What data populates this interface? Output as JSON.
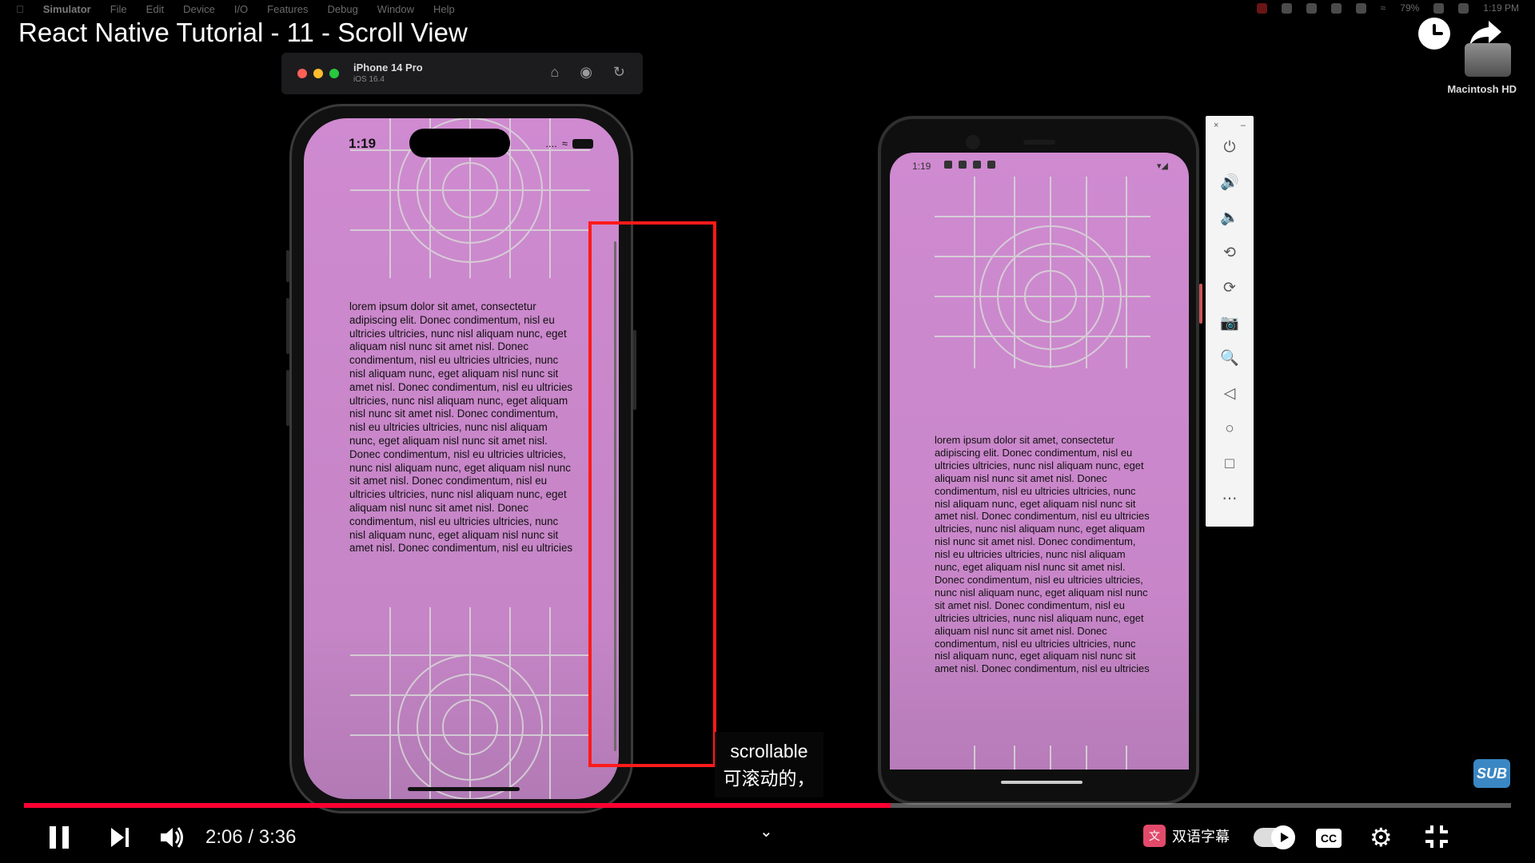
{
  "menubar": {
    "app": "Simulator",
    "items": [
      "File",
      "Edit",
      "Device",
      "I/O",
      "Features",
      "Debug",
      "Window",
      "Help"
    ],
    "right": {
      "battery": "79%",
      "clock": "1:19 PM"
    }
  },
  "video": {
    "title": "React Native Tutorial - 11 - Scroll View",
    "caption_line1": "scrollable",
    "caption_line2": "可滚动的，",
    "sub_badge": "SUB",
    "desktop_drive_label": "Macintosh HD"
  },
  "simulator": {
    "device_name": "iPhone 14 Pro",
    "os_version": "iOS 16.4"
  },
  "ios": {
    "time": "1:19",
    "signal": "....",
    "lorem": "lorem ipsum dolor sit amet, consectetur adipiscing elit. Donec condimentum, nisl eu ultricies ultricies, nunc nisl aliquam nunc, eget aliquam nisl nunc sit amet nisl. Donec condimentum, nisl eu ultricies ultricies, nunc nisl aliquam nunc, eget aliquam nisl nunc sit amet nisl. Donec condimentum, nisl eu ultricies ultricies, nunc nisl aliquam nunc, eget aliquam nisl nunc sit amet nisl. Donec condimentum, nisl eu ultricies ultricies, nunc nisl aliquam nunc, eget aliquam nisl nunc sit amet nisl. Donec condimentum, nisl eu ultricies ultricies, nunc nisl aliquam nunc, eget aliquam nisl nunc sit amet nisl. Donec condimentum, nisl eu ultricies ultricies, nunc nisl aliquam nunc, eget aliquam nisl nunc sit amet nisl. Donec condimentum, nisl eu ultricies ultricies, nunc nisl aliquam nunc, eget aliquam nisl nunc sit amet nisl. Donec condimentum, nisl eu ultricies"
  },
  "android": {
    "time": "1:19",
    "lorem": "lorem ipsum dolor sit amet, consectetur adipiscing elit. Donec condimentum, nisl eu ultricies ultricies, nunc nisl aliquam nunc, eget aliquam nisl nunc sit amet nisl. Donec condimentum, nisl eu ultricies ultricies, nunc nisl aliquam nunc, eget aliquam nisl nunc sit amet nisl. Donec condimentum, nisl eu ultricies ultricies, nunc nisl aliquam nunc, eget aliquam nisl nunc sit amet nisl. Donec condimentum, nisl eu ultricies ultricies, nunc nisl aliquam nunc, eget aliquam nisl nunc sit amet nisl. Donec condimentum, nisl eu ultricies ultricies, nunc nisl aliquam nunc, eget aliquam nisl nunc sit amet nisl. Donec condimentum, nisl eu ultricies ultricies, nunc nisl aliquam nunc, eget aliquam nisl nunc sit amet nisl. Donec condimentum, nisl eu ultricies ultricies, nunc nisl aliquam nunc, eget aliquam nisl nunc sit amet nisl. Donec condimentum, nisl eu ultricies"
  },
  "emulator_panel": {
    "close_label": "×",
    "minimize_label": "–",
    "buttons": [
      {
        "name": "power",
        "glyph": "⏻"
      },
      {
        "name": "volume-up",
        "glyph": "🔊"
      },
      {
        "name": "volume-down",
        "glyph": "🔈"
      },
      {
        "name": "rotate-left",
        "glyph": "⟲"
      },
      {
        "name": "rotate-right",
        "glyph": "⟳"
      },
      {
        "name": "screenshot",
        "glyph": "📷"
      },
      {
        "name": "zoom",
        "glyph": "🔍"
      },
      {
        "name": "back",
        "glyph": "◁"
      },
      {
        "name": "home",
        "glyph": "○"
      },
      {
        "name": "overview",
        "glyph": "□"
      },
      {
        "name": "more",
        "glyph": "⋯"
      }
    ]
  },
  "player": {
    "time_display": "2:06 / 3:36",
    "progress_fraction": 0.583,
    "dual_subtitle_label": "双语字幕",
    "cc_label": "CC",
    "chevron": "⌄"
  },
  "colors": {
    "progress": "#ff0033",
    "highlight_box": "#ff1a1a",
    "app_background": "#cf8ad0"
  }
}
